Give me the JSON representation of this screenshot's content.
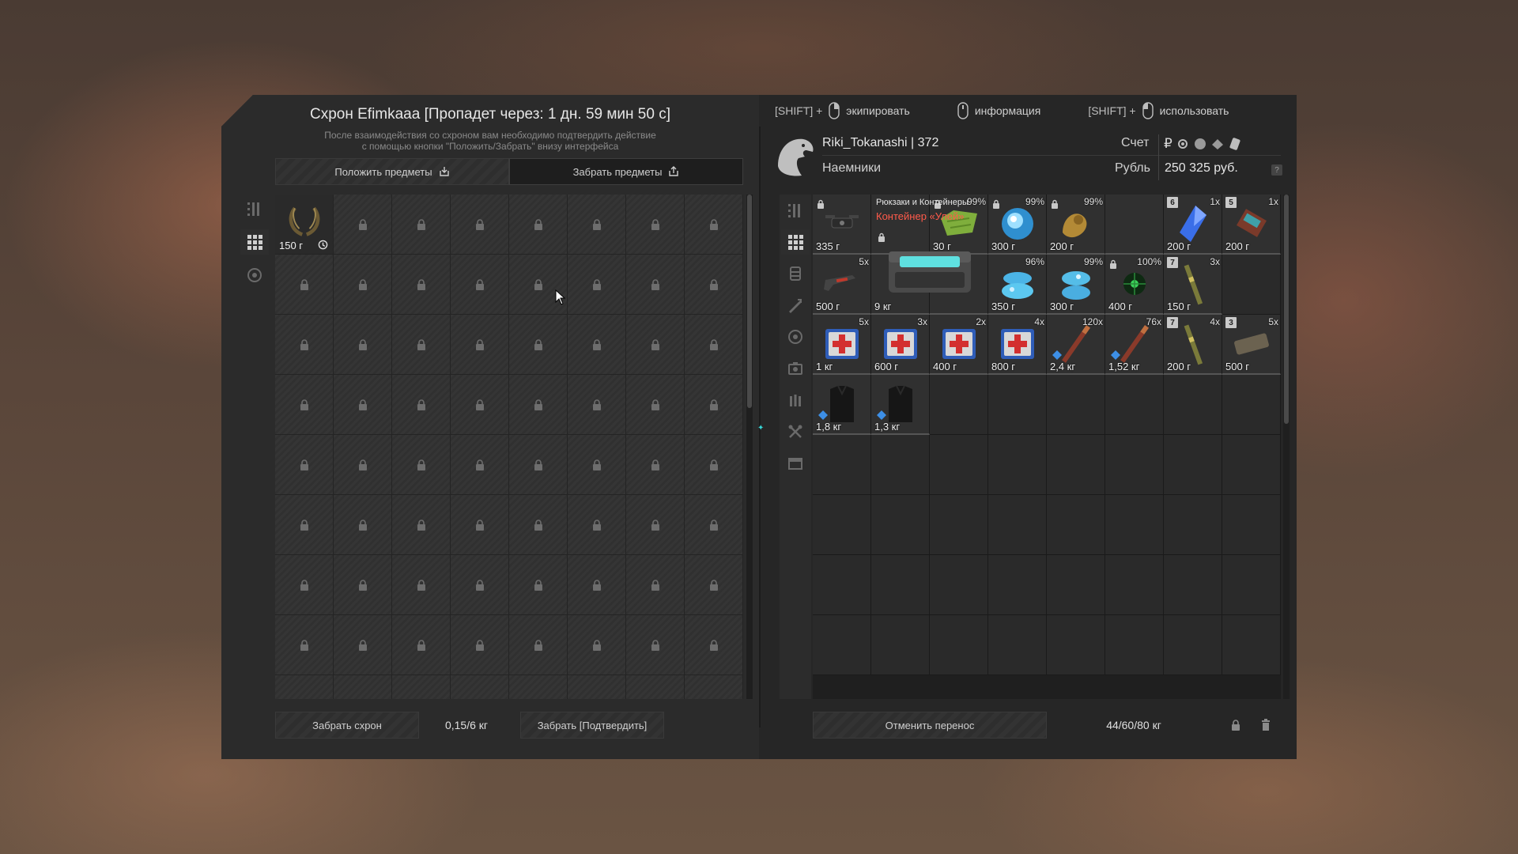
{
  "stash": {
    "title": "Схрон Efimkaaa [Пропадет через: 1 дн. 59 мин 50 с]",
    "hint_line1": "После взаимодействия со схроном вам необходимо подтвердить действие",
    "hint_line2": "с помощью кнопки \"Положить/Забрать\" внизу интерфейса",
    "tab_put": "Положить предметы",
    "tab_take": "Забрать предметы",
    "item": {
      "weight": "150 г",
      "icon": "wreath-icon"
    },
    "take_stash_label": "Забрать схрон",
    "weight": "0,15/6 кг",
    "take_confirm_label": "Забрать [Подтвердить]"
  },
  "hotkeys": {
    "equip_mod": "[SHIFT] +",
    "equip_label": "экипировать",
    "info_label": "информация",
    "use_mod": "[SHIFT] +",
    "use_label": "использовать"
  },
  "profile": {
    "name": "Riki_Tokanashi | 372",
    "group": "Наемники",
    "account_label": "Счет",
    "currency_name": "Рубль",
    "balance": "250 325 руб.",
    "ruble_symbol": "₽",
    "help": "?"
  },
  "inventory": {
    "container": {
      "category": "Рюкзаки и Контейнеры",
      "name": "Контейнер «Улей»",
      "weight": "9 кг"
    },
    "items": [
      {
        "id": "i1",
        "weight": "335 г",
        "locked": true,
        "icon": "drone-icon"
      },
      {
        "id": "i2",
        "weight": "30 г",
        "pct": "99%",
        "locked": true,
        "icon": "map-icon"
      },
      {
        "id": "i3",
        "weight": "300 г",
        "pct": "99%",
        "locked": true,
        "icon": "artifact-blue-icon"
      },
      {
        "id": "i4",
        "weight": "200 г",
        "pct": "99%",
        "locked": true,
        "icon": "artifact-gold-icon"
      },
      {
        "id": "i5",
        "weight": "200 г",
        "qty": "1x",
        "level": "6",
        "icon": "crystal-icon"
      },
      {
        "id": "i6",
        "weight": "200 г",
        "qty": "1x",
        "level": "5",
        "icon": "device-icon"
      },
      {
        "id": "i7",
        "weight": "500 г",
        "qty": "5x",
        "icon": "gun-icon"
      },
      {
        "id": "i8",
        "weight": "350 г",
        "pct": "96%",
        "icon": "artifact-ice-icon"
      },
      {
        "id": "i9",
        "weight": "300 г",
        "pct": "99%",
        "icon": "artifact-ice2-icon"
      },
      {
        "id": "i10",
        "weight": "400 г",
        "pct": "100%",
        "locked": true,
        "icon": "artifact-green-icon"
      },
      {
        "id": "i11",
        "weight": "150 г",
        "qty": "3x",
        "level": "7",
        "icon": "rod-icon"
      },
      {
        "id": "i12",
        "weight": "1 кг",
        "qty": "5x",
        "icon": "medkit-icon"
      },
      {
        "id": "i13",
        "weight": "600 г",
        "qty": "3x",
        "icon": "medkit-icon"
      },
      {
        "id": "i14",
        "weight": "400 г",
        "qty": "2x",
        "icon": "medkit-icon"
      },
      {
        "id": "i15",
        "weight": "800 г",
        "qty": "4x",
        "icon": "medkit-icon"
      },
      {
        "id": "i16",
        "weight": "2,4 кг",
        "qty": "120x",
        "icon": "ammo-icon"
      },
      {
        "id": "i17",
        "weight": "1,52 кг",
        "qty": "76x",
        "icon": "ammo-icon"
      },
      {
        "id": "i18",
        "weight": "200 г",
        "qty": "4x",
        "level": "7",
        "icon": "rod-icon"
      },
      {
        "id": "i19",
        "weight": "500 г",
        "qty": "5x",
        "level": "3",
        "icon": "brick-icon"
      },
      {
        "id": "i20",
        "weight": "1,8 кг",
        "icon": "armor-icon"
      },
      {
        "id": "i21",
        "weight": "1,3 кг",
        "icon": "armor-icon"
      }
    ],
    "cancel_label": "Отменить перенос",
    "weight": "44/60/80 кг"
  },
  "colors": {
    "container_name": "#ff5a4a",
    "panel": "#262626",
    "accent": "#38d7d7"
  }
}
